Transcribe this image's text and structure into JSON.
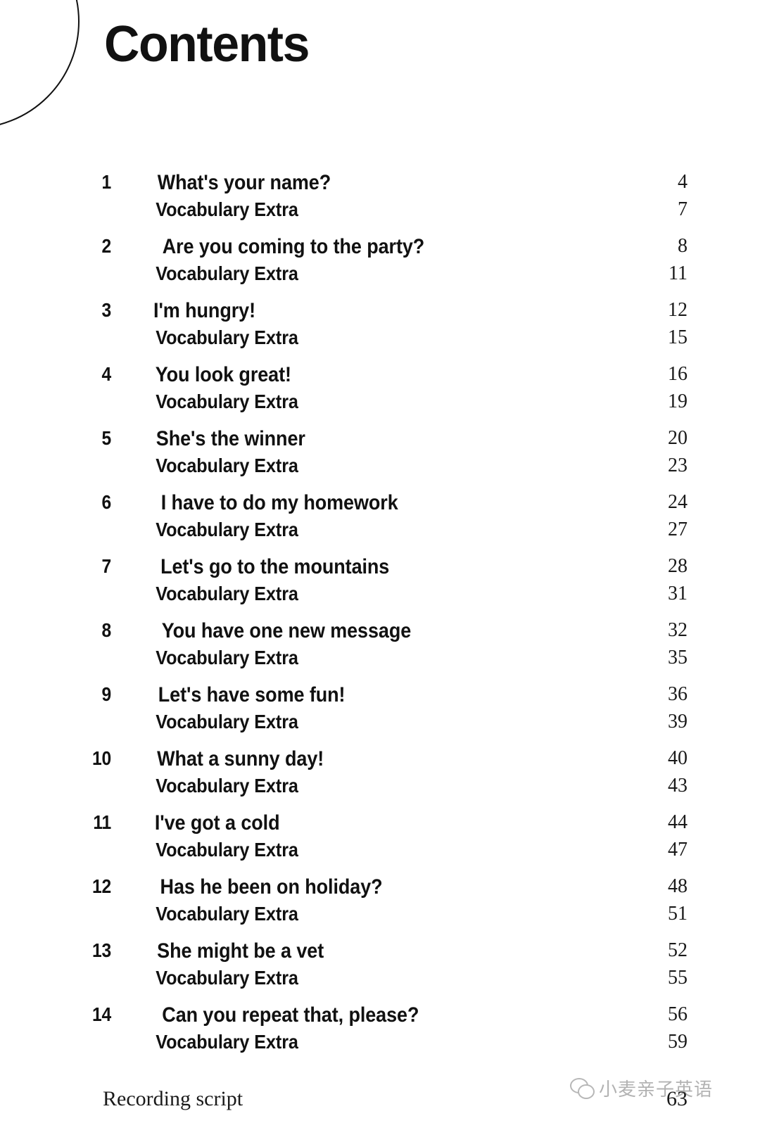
{
  "page": {
    "title": "Contents",
    "background_color": "#ffffff",
    "text_color": "#111111"
  },
  "decoration": {
    "arc_name": "circle-outline"
  },
  "toc": {
    "subentry_label": "Vocabulary Extra",
    "entries": [
      {
        "number": "1",
        "title": "What's your name?",
        "page": "4",
        "sub_page": "7"
      },
      {
        "number": "2",
        "title": "Are you coming to the party?",
        "page": "8",
        "sub_page": "11"
      },
      {
        "number": "3",
        "title": "I'm hungry!",
        "page": "12",
        "sub_page": "15"
      },
      {
        "number": "4",
        "title": "You look great!",
        "page": "16",
        "sub_page": "19"
      },
      {
        "number": "5",
        "title": "She's the winner",
        "page": "20",
        "sub_page": "23"
      },
      {
        "number": "6",
        "title": "I have to do my homework",
        "page": "24",
        "sub_page": "27"
      },
      {
        "number": "7",
        "title": "Let's go to the mountains",
        "page": "28",
        "sub_page": "31"
      },
      {
        "number": "8",
        "title": "You have one new message",
        "page": "32",
        "sub_page": "35"
      },
      {
        "number": "9",
        "title": "Let's have some fun!",
        "page": "36",
        "sub_page": "39"
      },
      {
        "number": "10",
        "title": "What a sunny day!",
        "page": "40",
        "sub_page": "43"
      },
      {
        "number": "11",
        "title": "I've got a cold",
        "page": "44",
        "sub_page": "47"
      },
      {
        "number": "12",
        "title": "Has he been on holiday?",
        "page": "48",
        "sub_page": "51"
      },
      {
        "number": "13",
        "title": "She might be a vet",
        "page": "52",
        "sub_page": "55"
      },
      {
        "number": "14",
        "title": "Can you repeat that, please?",
        "page": "56",
        "sub_page": "59"
      }
    ]
  },
  "footer": {
    "label": "Recording script",
    "page": "63"
  },
  "watermark": {
    "text": "小麦亲子英语",
    "icon": "wechat-icon"
  }
}
